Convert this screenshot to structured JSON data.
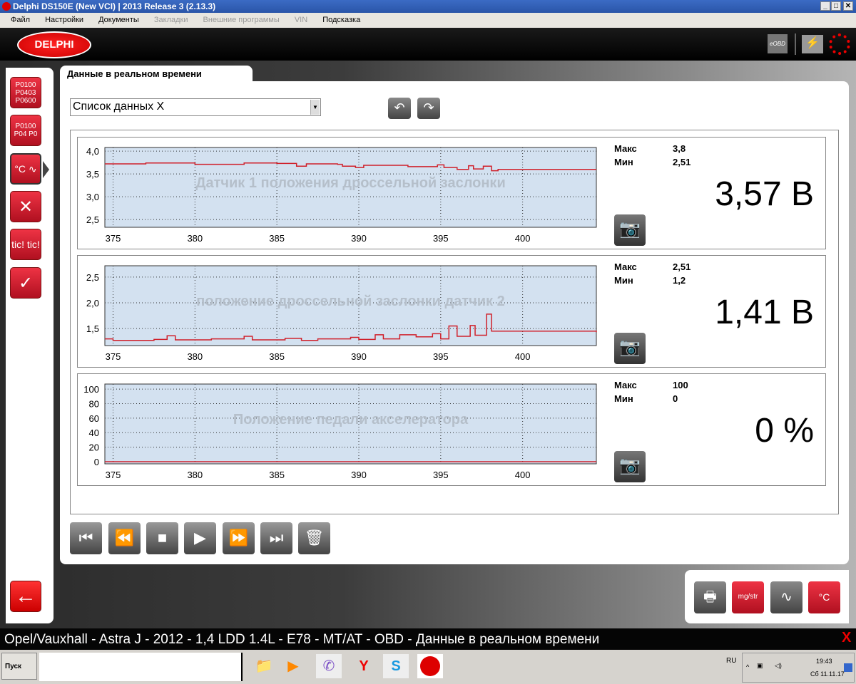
{
  "window": {
    "title": "Delphi DS150E (New VCI) | 2013 Release 3 (2.13.3)",
    "min": "_",
    "max": "□",
    "close": "✕"
  },
  "menu": [
    {
      "label": "Файл",
      "enabled": true
    },
    {
      "label": "Настройки",
      "enabled": true
    },
    {
      "label": "Документы",
      "enabled": true
    },
    {
      "label": "Закладки",
      "enabled": false
    },
    {
      "label": "Внешние программы",
      "enabled": false
    },
    {
      "label": "VIN",
      "enabled": false
    },
    {
      "label": "Подсказка",
      "enabled": true
    }
  ],
  "header": {
    "logo": "DELPHI",
    "eobd": "eOBD",
    "battery_icon": "⚡",
    "spinner_icon": "loading-icon"
  },
  "sidebar": {
    "items": [
      {
        "name": "fault-codes",
        "label": "P0100 P0403 P0600"
      },
      {
        "name": "clear-codes",
        "label": "P0100 P04 P0"
      },
      {
        "name": "live-data",
        "label": "°C ∿"
      },
      {
        "name": "service",
        "label": "✕"
      },
      {
        "name": "tic",
        "label": "tic! tic!"
      },
      {
        "name": "actuators",
        "label": "✓"
      }
    ],
    "back": "←"
  },
  "tab": {
    "label": "Данные в реальном времени"
  },
  "list": {
    "value": "Список данных X",
    "prev": "↶",
    "next": "↷"
  },
  "charts": [
    {
      "title": "Датчик 1 положения дроссельной заслонки",
      "max_label": "Макс",
      "max": "3,8",
      "min_label": "Мин",
      "min": "2,51",
      "value": "3,57 В",
      "yticks": [
        "4,0",
        "3,5",
        "3,0",
        "2,5"
      ],
      "yvals": [
        4.0,
        3.5,
        3.0,
        2.5
      ],
      "ylim": [
        2.33,
        4.08
      ],
      "series": [
        [
          374.5,
          3.72
        ],
        [
          377,
          3.74
        ],
        [
          380,
          3.71
        ],
        [
          383,
          3.74
        ],
        [
          385,
          3.73
        ],
        [
          386.2,
          3.67
        ],
        [
          386.8,
          3.72
        ],
        [
          388.7,
          3.71
        ],
        [
          389,
          3.67
        ],
        [
          389.8,
          3.64
        ],
        [
          390.3,
          3.69
        ],
        [
          393,
          3.66
        ],
        [
          394.8,
          3.7
        ],
        [
          395.2,
          3.64
        ],
        [
          396,
          3.6
        ],
        [
          396.7,
          3.68
        ],
        [
          397,
          3.61
        ],
        [
          397.6,
          3.67
        ],
        [
          398.1,
          3.57
        ],
        [
          398.5,
          3.6
        ],
        [
          404.5,
          3.6
        ]
      ]
    },
    {
      "title": "положение дроссельной заслонки датчик 2",
      "max_label": "Макс",
      "max": "2,51",
      "min_label": "Мин",
      "min": "1,2",
      "value": "1,41 В",
      "yticks": [
        "2,5",
        "2,0",
        "1,5"
      ],
      "yvals": [
        2.5,
        2.0,
        1.5
      ],
      "ylim": [
        1.17,
        2.72
      ],
      "series": [
        [
          374.5,
          1.3
        ],
        [
          375,
          1.27
        ],
        [
          377.5,
          1.29
        ],
        [
          378.3,
          1.36
        ],
        [
          378.8,
          1.28
        ],
        [
          381,
          1.3
        ],
        [
          383,
          1.35
        ],
        [
          383.5,
          1.28
        ],
        [
          385.5,
          1.31
        ],
        [
          386.5,
          1.27
        ],
        [
          387.5,
          1.3
        ],
        [
          389.5,
          1.33
        ],
        [
          390,
          1.29
        ],
        [
          391,
          1.38
        ],
        [
          391.5,
          1.3
        ],
        [
          392.5,
          1.38
        ],
        [
          393.5,
          1.34
        ],
        [
          394.5,
          1.4
        ],
        [
          395,
          1.3
        ],
        [
          395.5,
          1.55
        ],
        [
          396,
          1.35
        ],
        [
          396.8,
          1.56
        ],
        [
          397.1,
          1.37
        ],
        [
          397.8,
          1.78
        ],
        [
          398.1,
          1.45
        ],
        [
          404.5,
          1.43
        ]
      ]
    },
    {
      "title": "Положение педали акселератора",
      "max_label": "Макс",
      "max": "100",
      "min_label": "Мин",
      "min": "0",
      "value": "0 %",
      "yticks": [
        "100",
        "80",
        "60",
        "40",
        "20",
        "0"
      ],
      "yvals": [
        100,
        80,
        60,
        40,
        20,
        0
      ],
      "ylim": [
        -3,
        107
      ],
      "series": [
        [
          374.5,
          0
        ],
        [
          404.5,
          0
        ]
      ]
    }
  ],
  "chart_data": [
    {
      "type": "line",
      "title": "Датчик 1 положения дроссельной заслонки",
      "xlim": [
        374.5,
        404.5
      ],
      "xticks": [
        375,
        380,
        385,
        390,
        395,
        400
      ],
      "ylim": [
        2.33,
        4.08
      ],
      "unit": "В"
    },
    {
      "type": "line",
      "title": "положение дроссельной заслонки датчик 2",
      "xlim": [
        374.5,
        404.5
      ],
      "xticks": [
        375,
        380,
        385,
        390,
        395,
        400
      ],
      "ylim": [
        1.17,
        2.72
      ],
      "unit": "В"
    },
    {
      "type": "line",
      "title": "Положение педали акселератора",
      "xlim": [
        374.5,
        404.5
      ],
      "xticks": [
        375,
        380,
        385,
        390,
        395,
        400
      ],
      "ylim": [
        -3,
        107
      ],
      "unit": "%"
    }
  ],
  "xticks": [
    "375",
    "380",
    "385",
    "390",
    "395",
    "400"
  ],
  "xvals": [
    375,
    380,
    385,
    390,
    395,
    400
  ],
  "xlim": [
    374.5,
    404.5
  ],
  "playback": [
    {
      "name": "first",
      "icon": "⏮"
    },
    {
      "name": "rewind",
      "icon": "⏪"
    },
    {
      "name": "stop",
      "icon": "■"
    },
    {
      "name": "play",
      "icon": "▶"
    },
    {
      "name": "forward",
      "icon": "⏩"
    },
    {
      "name": "last",
      "icon": "⏭"
    },
    {
      "name": "delete",
      "icon": "🗑"
    }
  ],
  "tools": [
    {
      "name": "print",
      "icon": "🖶"
    },
    {
      "name": "units",
      "icon": "mg/str"
    },
    {
      "name": "graph",
      "icon": "∿"
    },
    {
      "name": "live-data",
      "icon": "°C"
    }
  ],
  "status": {
    "text": "Opel/Vauxhall - Astra J - 2012 - 1,4 LDD 1.4L - E78 - MT/AT - OBD - Данные в реальном времени",
    "close": "X"
  },
  "taskbar": {
    "start": "Пуск",
    "lang": "RU",
    "time": "19:43",
    "date": "Сб 11.11.17"
  },
  "colors": {
    "accent": "#cc0000",
    "plot_bg": "#d3e1f0",
    "line": "#d0202a"
  }
}
